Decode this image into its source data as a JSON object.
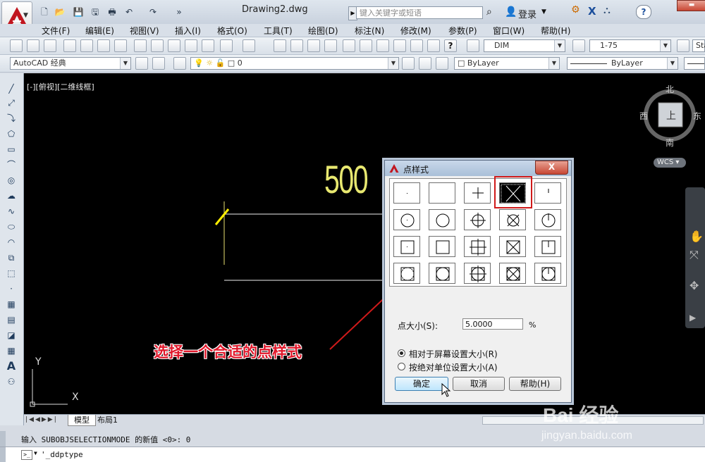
{
  "window": {
    "document_title": "Drawing2.dwg",
    "search_placeholder": "键入关键字或短语",
    "login_label": "登录",
    "help_label": "?"
  },
  "menu": [
    "文件(F)",
    "编辑(E)",
    "视图(V)",
    "插入(I)",
    "格式(O)",
    "工具(T)",
    "绘图(D)",
    "标注(N)",
    "修改(M)",
    "参数(P)",
    "窗口(W)",
    "帮助(H)"
  ],
  "toolbar": {
    "dimstyle": "DIM",
    "tablestyle": "1-75",
    "textstyle_partial": "Sta",
    "workspace": "AutoCAD 经典",
    "layer": "0",
    "color": "ByLayer",
    "linetype": "ByLayer"
  },
  "viewport": {
    "label": "[-][俯视][二维线框]",
    "dimension_text": "500",
    "ucs_y": "Y",
    "ucs_x": "X"
  },
  "viewcube": {
    "north": "北",
    "south": "南",
    "west": "西",
    "east": "东",
    "top": "上",
    "wcs": "WCS"
  },
  "dialog": {
    "title": "点样式",
    "close": "X",
    "point_size_label": "点大小(S):",
    "point_size_value": "5.0000",
    "point_size_unit": "%",
    "radio_relative": "相对于屏幕设置大小(R)",
    "radio_absolute": "按绝对单位设置大小(A)",
    "ok": "确定",
    "cancel": "取消",
    "help": "帮助(H)",
    "selected_style": "X in square (row 1, col 4)"
  },
  "annotation": {
    "text": "选择一个合适的点样式",
    "color": "#e0182b"
  },
  "tabs": {
    "model": "模型",
    "layout1": "布局1"
  },
  "command": {
    "history": "输入 SUBOBJSELECTIONMODE 的新值 <0>: 0",
    "prompt": "'_ddptype"
  },
  "watermark": {
    "brand": "Bai 经验",
    "url": "jingyan.baidu.com"
  }
}
